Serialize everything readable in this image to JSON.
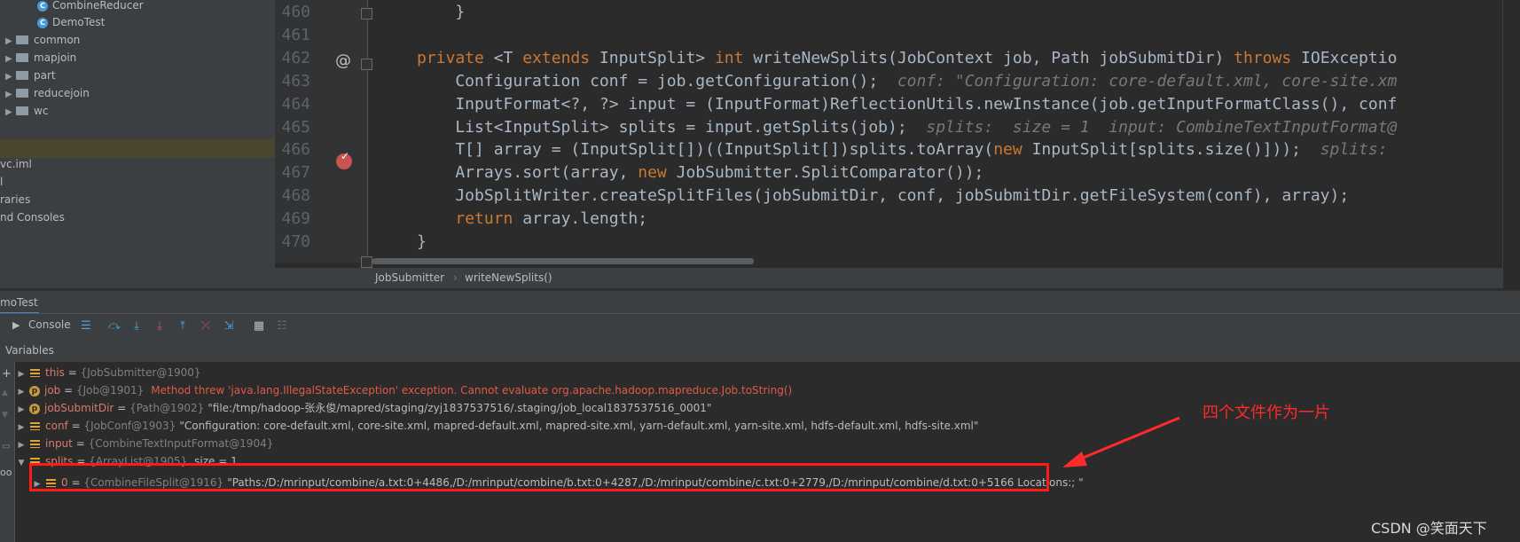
{
  "project_tree": {
    "items": [
      {
        "label": "CombineReducer",
        "type": "class"
      },
      {
        "label": "DemoTest",
        "type": "class"
      },
      {
        "label": "common",
        "type": "folder"
      },
      {
        "label": "mapjoin",
        "type": "folder"
      },
      {
        "label": "part",
        "type": "folder"
      },
      {
        "label": "reducejoin",
        "type": "folder"
      },
      {
        "label": "wc",
        "type": "folder"
      }
    ],
    "lower_items": [
      "vc.iml",
      "l",
      "raries",
      "nd Consoles"
    ]
  },
  "editor": {
    "line_numbers": [
      "460",
      "461",
      "462",
      "463",
      "464",
      "465",
      "466",
      "467",
      "468",
      "469",
      "470"
    ],
    "lines": [
      [
        {
          "t": "    }",
          "c": ""
        }
      ],
      [
        {
          "t": "",
          "c": ""
        }
      ],
      [
        {
          "t": "private",
          "c": "kw"
        },
        {
          "t": " <T ",
          "c": ""
        },
        {
          "t": "extends",
          "c": "kw"
        },
        {
          "t": " InputSplit> ",
          "c": ""
        },
        {
          "t": "int",
          "c": "kw"
        },
        {
          "t": " writeNewSplits(JobContext job, Path jobSubmitDir) ",
          "c": ""
        },
        {
          "t": "throws",
          "c": "kw"
        },
        {
          "t": " IOExceptio",
          "c": ""
        }
      ],
      [
        {
          "t": "    Configuration conf = job.getConfiguration();",
          "c": ""
        },
        {
          "t": "  conf: \"Configuration: core-default.xml, core-site.xm",
          "c": "hint"
        }
      ],
      [
        {
          "t": "    InputFormat<?, ?> input = (InputFormat)ReflectionUtils.newInstance(job.getInputFormatClass(), conf",
          "c": ""
        }
      ],
      [
        {
          "t": "    List<InputSplit> splits = input.getSplits(job);",
          "c": ""
        },
        {
          "t": "  splits:  size = 1  input: CombineTextInputFormat@",
          "c": "hint"
        }
      ],
      [
        {
          "t": "    T[] array = (InputSplit[])((InputSplit[])splits.toArray(",
          "c": ""
        },
        {
          "t": "new",
          "c": "kw"
        },
        {
          "t": " InputSplit[splits.size()]));",
          "c": ""
        },
        {
          "t": "  splits: ",
          "c": "hint"
        }
      ],
      [
        {
          "t": "    Arrays.sort(array, ",
          "c": ""
        },
        {
          "t": "new",
          "c": "kw"
        },
        {
          "t": " JobSubmitter.SplitComparator());",
          "c": ""
        }
      ],
      [
        {
          "t": "    JobSplitWriter.createSplitFiles(jobSubmitDir, conf, jobSubmitDir.getFileSystem(conf), array);",
          "c": ""
        }
      ],
      [
        {
          "t": "    ",
          "c": ""
        },
        {
          "t": "return",
          "c": "kw"
        },
        {
          "t": " array.length;",
          "c": ""
        }
      ],
      [
        {
          "t": "}",
          "c": ""
        }
      ]
    ],
    "gutter_marks": {
      "at_line": "462",
      "at_symbol": "@",
      "breakpoint_line": "466"
    },
    "breadcrumbs": [
      "JobSubmitter",
      "writeNewSplits()"
    ]
  },
  "debug": {
    "tab_title": "moTest",
    "console_label": "Console",
    "variables_label": "Variables",
    "variables": [
      {
        "indent": 0,
        "icon": "field",
        "name": "this",
        "eq": " = ",
        "type": "{JobSubmitter@1900}",
        "value": "",
        "error": ""
      },
      {
        "indent": 0,
        "icon": "param",
        "name": "job",
        "eq": " = ",
        "type": "{Job@1901}",
        "value": "",
        "error": "Method threw 'java.lang.IllegalStateException' exception. Cannot evaluate org.apache.hadoop.mapreduce.Job.toString()"
      },
      {
        "indent": 0,
        "icon": "param",
        "name": "jobSubmitDir",
        "eq": " = ",
        "type": "{Path@1902}",
        "value": "\"file:/tmp/hadoop-张永俊/mapred/staging/zyj1837537516/.staging/job_local1837537516_0001\"",
        "error": ""
      },
      {
        "indent": 0,
        "icon": "field",
        "name": "conf",
        "eq": " = ",
        "type": "{JobConf@1903}",
        "value": "\"Configuration: core-default.xml, core-site.xml, mapred-default.xml, mapred-site.xml, yarn-default.xml, yarn-site.xml, hdfs-default.xml, hdfs-site.xml\"",
        "error": ""
      },
      {
        "indent": 0,
        "icon": "field",
        "name": "input",
        "eq": " = ",
        "type": "{CombineTextInputFormat@1904}",
        "value": "",
        "error": ""
      },
      {
        "indent": 0,
        "icon": "field",
        "name": "splits",
        "eq": " = ",
        "type": "{ArrayList@1905}",
        "value": " size = 1",
        "error": ""
      },
      {
        "indent": 1,
        "icon": "field",
        "name": "0",
        "eq": " = ",
        "type": "{CombineFileSplit@1916}",
        "value": "\"Paths:/D:/mrinput/combine/a.txt:0+4486,/D:/mrinput/combine/b.txt:0+4287,/D:/mrinput/combine/c.txt:0+2779,/D:/mrinput/combine/d.txt:0+5166 Locations:; \"",
        "error": ""
      }
    ]
  },
  "annotation": "四个文件作为一片",
  "watermark": "CSDN @笑面天下",
  "colors": {
    "highlight_border": "#ff1a1a",
    "annotation": "#ff2a2a",
    "current_line": "#2d5a8a"
  }
}
